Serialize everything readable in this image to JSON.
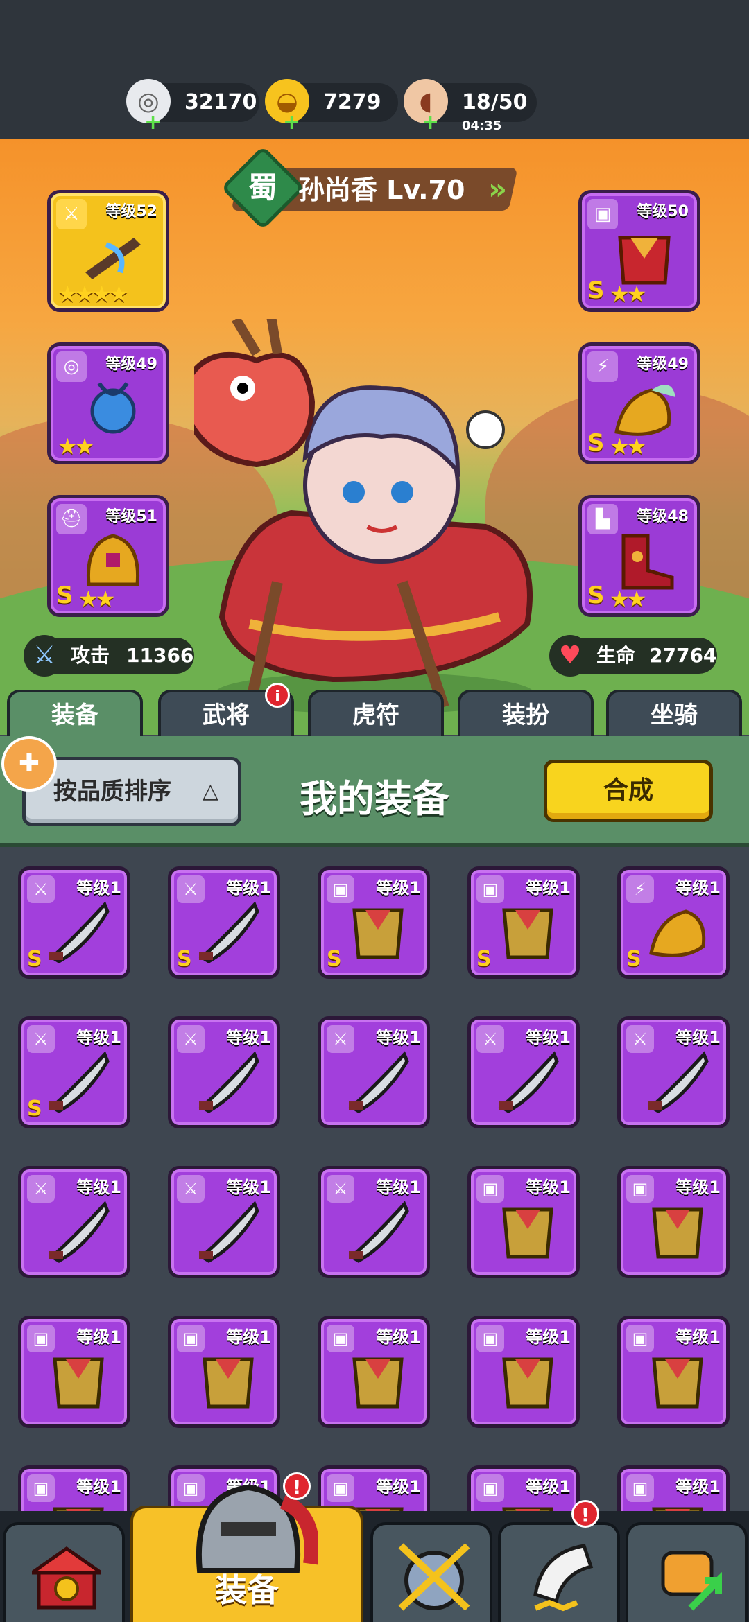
{
  "resources": [
    {
      "name": "silver-coin",
      "value": "32170"
    },
    {
      "name": "gold-ingot",
      "value": "7279"
    },
    {
      "name": "stamina-meat",
      "value": "18/50",
      "timer": "04:35"
    }
  ],
  "hero": {
    "faction": "蜀",
    "name": "孙尚香 Lv.70"
  },
  "equip_slots": {
    "left": [
      {
        "level": "等级52",
        "type_icon": "sword-icon",
        "grade": "",
        "stars": 4,
        "rarity": "gold"
      },
      {
        "level": "等级49",
        "type_icon": "medal-icon",
        "grade": "",
        "stars": 2,
        "rarity": "purple"
      },
      {
        "level": "等级51",
        "type_icon": "helmet-icon",
        "grade": "S",
        "stars": 2,
        "rarity": "purple"
      }
    ],
    "right": [
      {
        "level": "等级50",
        "type_icon": "armor-icon",
        "grade": "S",
        "stars": 2,
        "rarity": "purple"
      },
      {
        "level": "等级49",
        "type_icon": "scroll-icon",
        "grade": "S",
        "stars": 2,
        "rarity": "purple"
      },
      {
        "level": "等级48",
        "type_icon": "boot-icon",
        "grade": "S",
        "stars": 2,
        "rarity": "purple"
      }
    ]
  },
  "stats": {
    "attack_label": "攻击",
    "attack_value": "11366",
    "hp_label": "生命",
    "hp_value": "27764"
  },
  "tabs": [
    "装备",
    "武将",
    "虎符",
    "装扮",
    "坐骑"
  ],
  "tab_badge": "i",
  "panel": {
    "sort_label": "按品质排序",
    "sort_arrow": "△",
    "title": "我的装备",
    "merge_label": "合成"
  },
  "inventory": [
    {
      "level": "等级1",
      "type": "sword",
      "grade": "S"
    },
    {
      "level": "等级1",
      "type": "sword",
      "grade": "S"
    },
    {
      "level": "等级1",
      "type": "armor",
      "grade": "S"
    },
    {
      "level": "等级1",
      "type": "armor",
      "grade": "S"
    },
    {
      "level": "等级1",
      "type": "scroll",
      "grade": "S"
    },
    {
      "level": "等级1",
      "type": "sword",
      "grade": "S"
    },
    {
      "level": "等级1",
      "type": "sword",
      "grade": ""
    },
    {
      "level": "等级1",
      "type": "sword",
      "grade": ""
    },
    {
      "level": "等级1",
      "type": "sword",
      "grade": ""
    },
    {
      "level": "等级1",
      "type": "sword",
      "grade": ""
    },
    {
      "level": "等级1",
      "type": "sword",
      "grade": ""
    },
    {
      "level": "等级1",
      "type": "sword",
      "grade": ""
    },
    {
      "level": "等级1",
      "type": "sword",
      "grade": ""
    },
    {
      "level": "等级1",
      "type": "armor",
      "grade": ""
    },
    {
      "level": "等级1",
      "type": "armor",
      "grade": ""
    },
    {
      "level": "等级1",
      "type": "armor",
      "grade": ""
    },
    {
      "level": "等级1",
      "type": "armor",
      "grade": ""
    },
    {
      "level": "等级1",
      "type": "armor",
      "grade": ""
    },
    {
      "level": "等级1",
      "type": "armor",
      "grade": ""
    },
    {
      "level": "等级1",
      "type": "armor",
      "grade": ""
    },
    {
      "level": "等级1",
      "type": "armor",
      "grade": ""
    },
    {
      "level": "等级1",
      "type": "armor",
      "grade": ""
    },
    {
      "level": "等级1",
      "type": "armor",
      "grade": ""
    },
    {
      "level": "等级1",
      "type": "armor",
      "grade": ""
    },
    {
      "level": "等级1",
      "type": "armor",
      "grade": ""
    }
  ],
  "bottom_nav": {
    "active_label": "装备",
    "badge": "!"
  },
  "colors": {
    "purple_rarity": "#a23fdc",
    "gold_rarity": "#f4c21c",
    "accent_yellow": "#f8d41e",
    "panel_green": "#5a8f67"
  }
}
